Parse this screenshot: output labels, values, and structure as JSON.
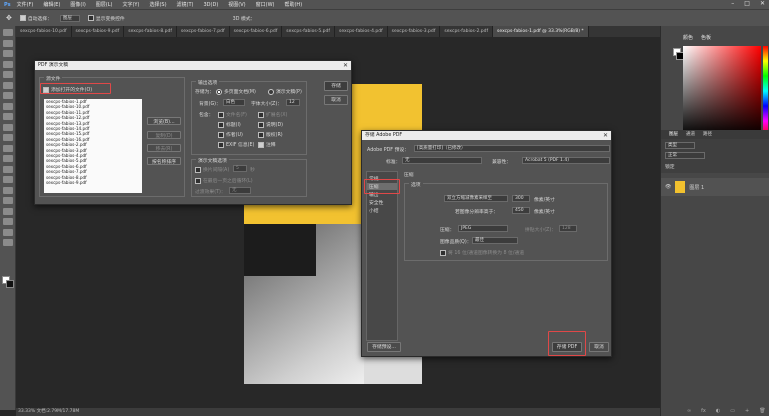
{
  "menu": [
    "文件(F)",
    "编辑(E)",
    "图像(I)",
    "图层(L)",
    "文字(Y)",
    "选择(S)",
    "滤镜(T)",
    "3D(D)",
    "视图(V)",
    "窗口(W)",
    "帮助(H)"
  ],
  "options": {
    "auto_select": "自动选择：",
    "layer": "图层",
    "show_transform": "显示变换控件",
    "mode3d": "3D 模式："
  },
  "tabs": [
    "sexcps-fabios-10.pdf",
    "sexcps-fabios-9.pdf",
    "sexcps-fabios-8.pdf",
    "sexcps-fabios-7.pdf",
    "sexcps-fabios-6.pdf",
    "sexcps-fabios-5.pdf",
    "sexcps-fabios-4.pdf",
    "sexcps-fabios-3.pdf",
    "sexcps-fabios-2.pdf",
    "sexcps-fabios-1.pdf @ 33.3%(RGB/8) *"
  ],
  "status": "33.33%    文档:2.79M/17.78M",
  "right_tabs": [
    "颜色",
    "色板"
  ],
  "layers": {
    "tabs": [
      "图层",
      "通道",
      "路径"
    ],
    "kind": "类型",
    "mode": "正常",
    "lock": "锁定",
    "layer_name": "图层 1"
  },
  "pdf": {
    "title": "PDF 演示文稿",
    "source_group": "源文件",
    "add_open": "添加打开的文件(O)",
    "files": [
      "sexcps-fabios-1.pdf",
      "sexcps-fabios-10.pdf",
      "sexcps-fabios-11.pdf",
      "sexcps-fabios-12.pdf",
      "sexcps-fabios-13.pdf",
      "sexcps-fabios-14.pdf",
      "sexcps-fabios-15.pdf",
      "sexcps-fabios-16.pdf",
      "sexcps-fabios-2.pdf",
      "sexcps-fabios-3.pdf",
      "sexcps-fabios-4.pdf",
      "sexcps-fabios-5.pdf",
      "sexcps-fabios-6.pdf",
      "sexcps-fabios-7.pdf",
      "sexcps-fabios-8.pdf",
      "sexcps-fabios-9.pdf"
    ],
    "browse": "浏览(B)...",
    "copy": "复制(D)",
    "remove": "移去(R)",
    "sort": "按名称排序",
    "output_group": "输出选项",
    "save_as": "存储为：",
    "multi_page": "多页面文档(M)",
    "presentation": "演示文稿(P)",
    "background": "背景(G)：",
    "bg_value": "白色",
    "font_size": "字体大小(Z)：",
    "font_value": "12",
    "include": "包含：",
    "filename": "文件名(F)",
    "extension": "扩展名(X)",
    "title_opt": "标题(I)",
    "desc": "说明(D)",
    "author": "作者(U)",
    "copyright": "版权(R)",
    "exif": "EXIF 信息(E)",
    "caption": "注释",
    "slideshow_group": "演示文稿选项",
    "advance": "换片间隔(A)",
    "seconds": "5",
    "sec_label": "秒",
    "loop": "在最后一页之后循环(L)",
    "transition": "过渡效果(T)：",
    "trans_value": "无",
    "save_btn": "存储",
    "cancel_btn": "取消"
  },
  "adobe": {
    "title": "存储 Adobe PDF",
    "preset_label": "Adobe PDF 预设：",
    "preset_value": "[高质量打印]（已修改）",
    "standard_label": "标准：",
    "standard_value": "无",
    "compat_label": "兼容性：",
    "compat_value": "Acrobat 5 (PDF 1.4)",
    "nav": [
      "常规",
      "压缩",
      "输出",
      "安全性",
      "小结"
    ],
    "section": "压缩",
    "options_label": "选项",
    "resample": "双立方缩减像素采样至",
    "ppi1": "300",
    "unit1": "像素/英寸",
    "above": "若图像分辨率高于：",
    "ppi2": "450",
    "unit2": "像素/英寸",
    "compression": "压缩：",
    "comp_value": "JPEG",
    "tile": "拼贴大小(Z)：",
    "tile_value": "128",
    "quality": "图像品质(Q)：",
    "quality_value": "最佳",
    "convert16": "将 16 位/通道图像转换为 8 位/通道",
    "save_preset": "存储预设...",
    "save_pdf": "存储 PDF",
    "cancel": "取消"
  }
}
